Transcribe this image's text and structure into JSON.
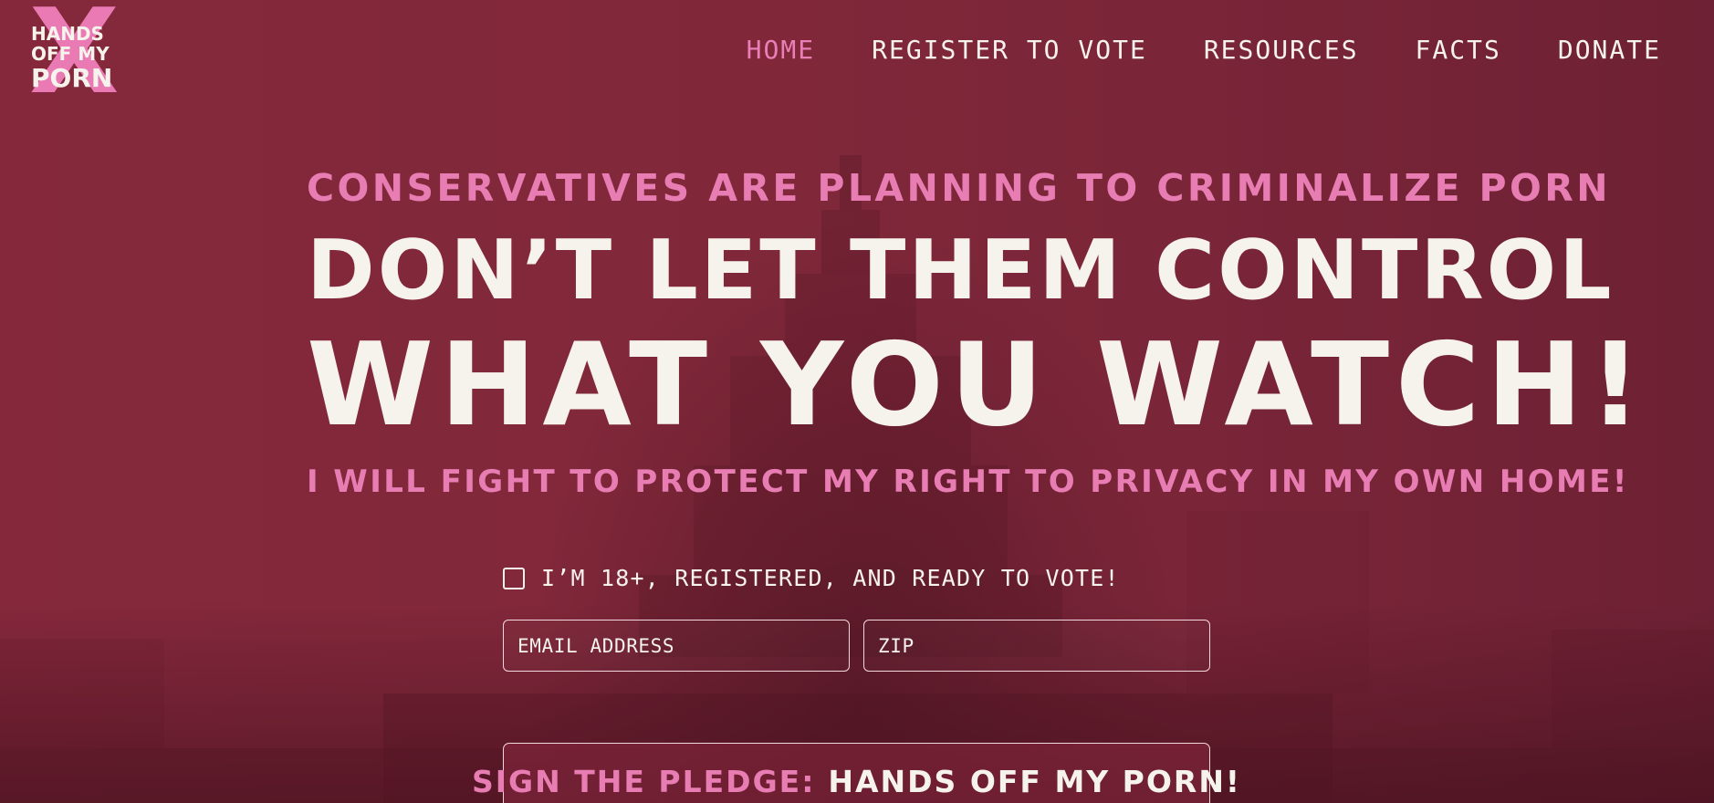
{
  "brand": {
    "logo_mark": "X",
    "logo_lines": [
      "HANDS",
      "OFF MY",
      "PORN"
    ]
  },
  "nav": {
    "items": [
      {
        "label": "HOME",
        "active": true
      },
      {
        "label": "REGISTER TO VOTE",
        "active": false
      },
      {
        "label": "RESOURCES",
        "active": false
      },
      {
        "label": "FACTS",
        "active": false
      },
      {
        "label": "DONATE",
        "active": false
      }
    ]
  },
  "hero": {
    "kicker": "CONSERVATIVES ARE PLANNING TO CRIMINALIZE PORN",
    "headline_line1": "DON’T LET THEM CONTROL",
    "headline_line2": "WHAT YOU WATCH!",
    "subline": "I WILL FIGHT TO PROTECT MY RIGHT TO PRIVACY IN MY OWN HOME!"
  },
  "form": {
    "checkbox_label": "I’M 18+, REGISTERED, AND READY TO VOTE!",
    "checkbox_checked": false,
    "email_placeholder": "EMAIL ADDRESS",
    "email_value": "",
    "zip_placeholder": "ZIP",
    "zip_value": "",
    "submit_label_prefix": "SIGN THE PLEDGE:",
    "submit_label_main": "HANDS OFF MY PORN!"
  },
  "colors": {
    "background": "#822a3c",
    "accent_pink": "#e77db3",
    "text_cream": "#f6f2ec"
  },
  "icons": {
    "logo": "x-logo-icon",
    "checkbox": "checkbox-icon"
  }
}
